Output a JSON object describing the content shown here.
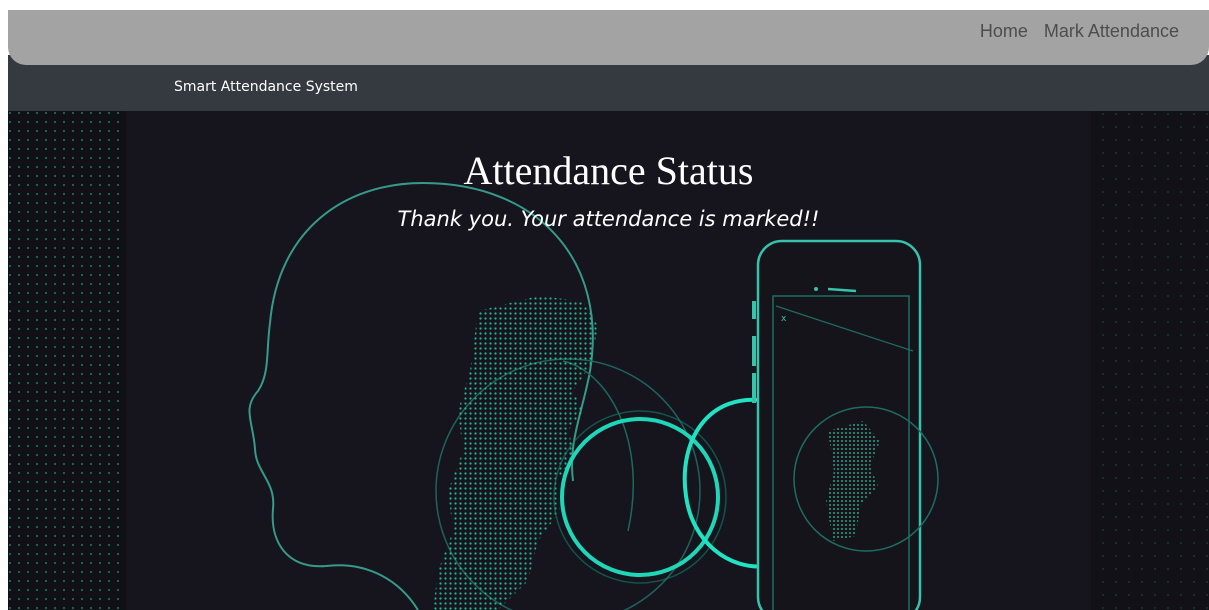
{
  "nav": {
    "links": [
      {
        "label": "Home"
      },
      {
        "label": "Mark Attendance"
      }
    ]
  },
  "brand": {
    "label": "Smart Attendance System"
  },
  "main": {
    "title": "Attendance Status",
    "message": "Thank you. Your attendance is marked!!"
  },
  "colors": {
    "topnav_bg": "#a3a3a3",
    "brandbar_bg": "#343a40",
    "hero_bg": "#16151d",
    "accent": "#1de0c0"
  },
  "icons": {
    "hero_art": "face-scan-illustration"
  }
}
